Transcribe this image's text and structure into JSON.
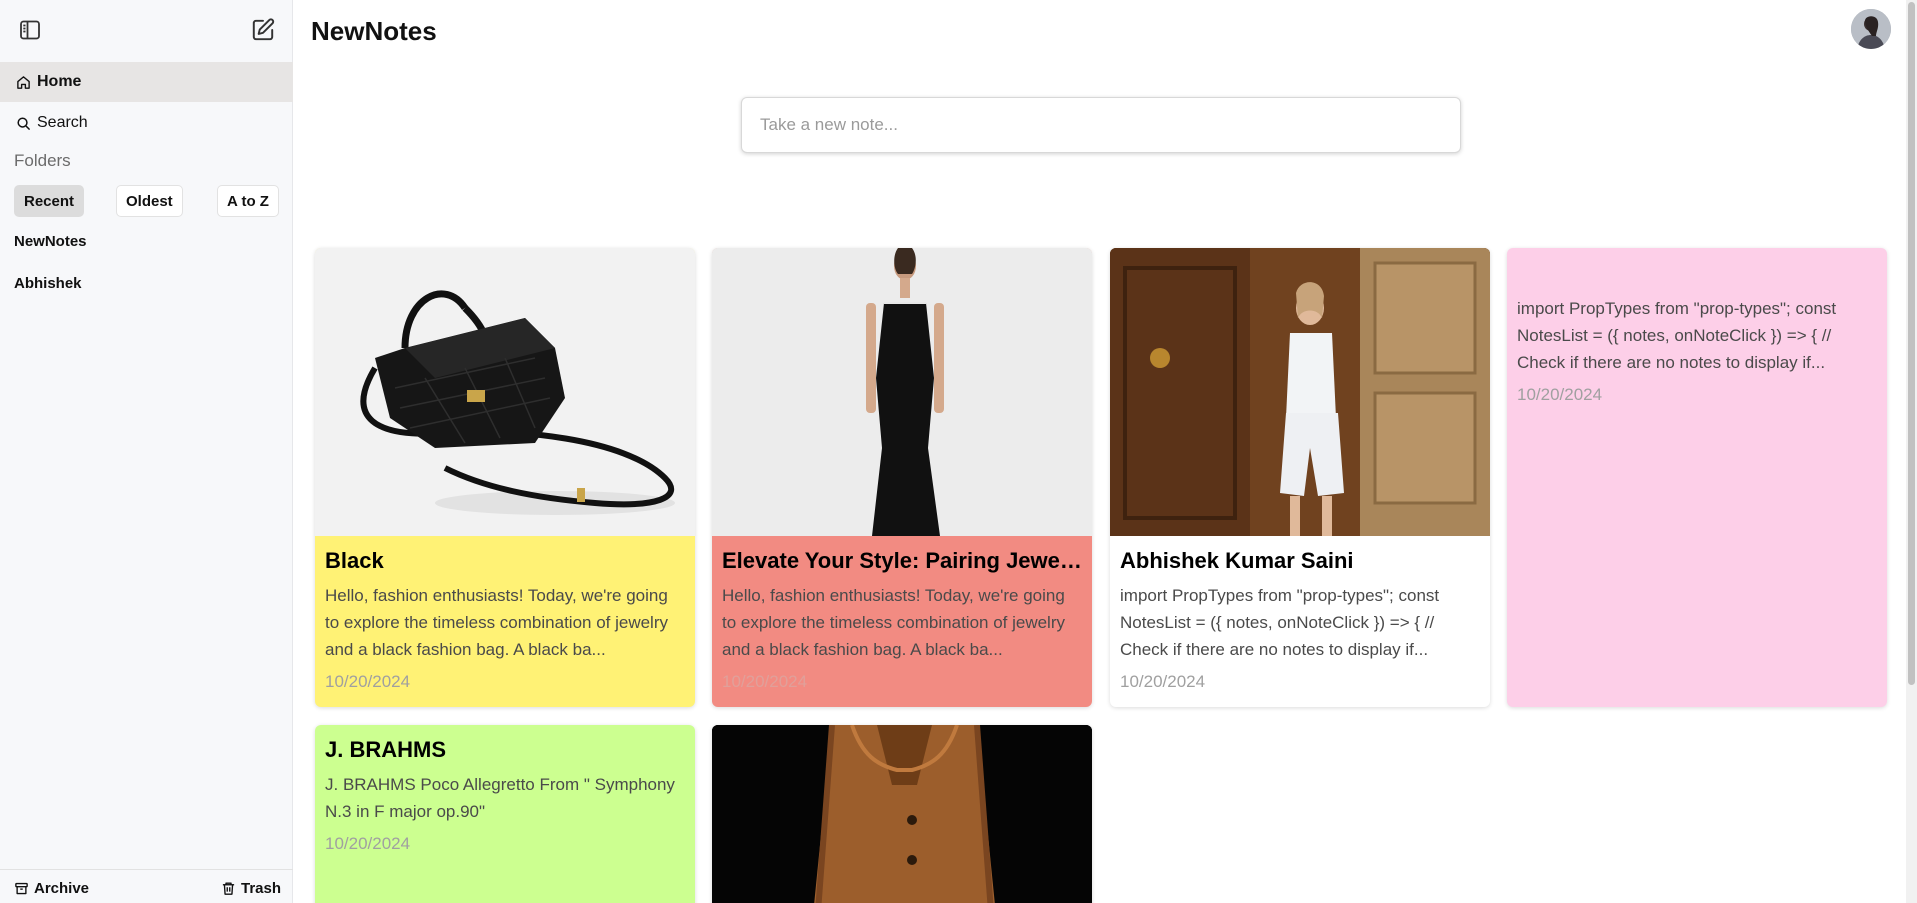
{
  "app": {
    "title": "NewNotes"
  },
  "sidebar": {
    "nav": [
      {
        "label": "Home",
        "icon": "home-icon"
      },
      {
        "label": "Search",
        "icon": "search-icon"
      }
    ],
    "folders_title": "Folders",
    "sort_buttons": [
      "Recent",
      "Oldest",
      "A to Z"
    ],
    "active_sort": "Recent",
    "folders": [
      "NewNotes",
      "Abhishek"
    ],
    "bottom": {
      "archive_label": "Archive",
      "trash_label": "Trash"
    }
  },
  "note_input": {
    "placeholder": "Take a new note..."
  },
  "notes": [
    {
      "title": "Black",
      "text": "Hello, fashion enthusiasts! Today, we're going to explore the timeless combination of jewelry and a black fashion bag. A black ba...",
      "date": "10/20/2024",
      "color": "#fff275",
      "image": "handbag"
    },
    {
      "title": "Elevate Your Style: Pairing Jewel...",
      "text": "Hello, fashion enthusiasts! Today, we're going to explore the timeless combination of jewelry and a black fashion bag. A black ba...",
      "date": "10/20/2024",
      "color": "#f28b82",
      "image": "black-dress"
    },
    {
      "title": "Abhishek Kumar Saini",
      "text": "import PropTypes from \"prop-types\"; const NotesList = ({ notes, onNoteClick }) => { // Check if there are no notes to display if...",
      "date": "10/20/2024",
      "color": "#ffffff",
      "image": "white-outfit"
    },
    {
      "title": "",
      "text": "import PropTypes from \"prop-types\"; const NotesList = ({ notes, onNoteClick }) => { // Check if there are no notes to display if...",
      "date": "10/20/2024",
      "color": "#fdcfe8"
    },
    {
      "title": "J. BRAHMS",
      "text": "J. BRAHMS Poco Allegretto From \" Symphony N.3 in F major op.90\"",
      "date": "10/20/2024",
      "color": "#ccff90"
    },
    {
      "title": "",
      "text": "",
      "date": "",
      "color": "#000000",
      "image": "leather-coat"
    }
  ]
}
